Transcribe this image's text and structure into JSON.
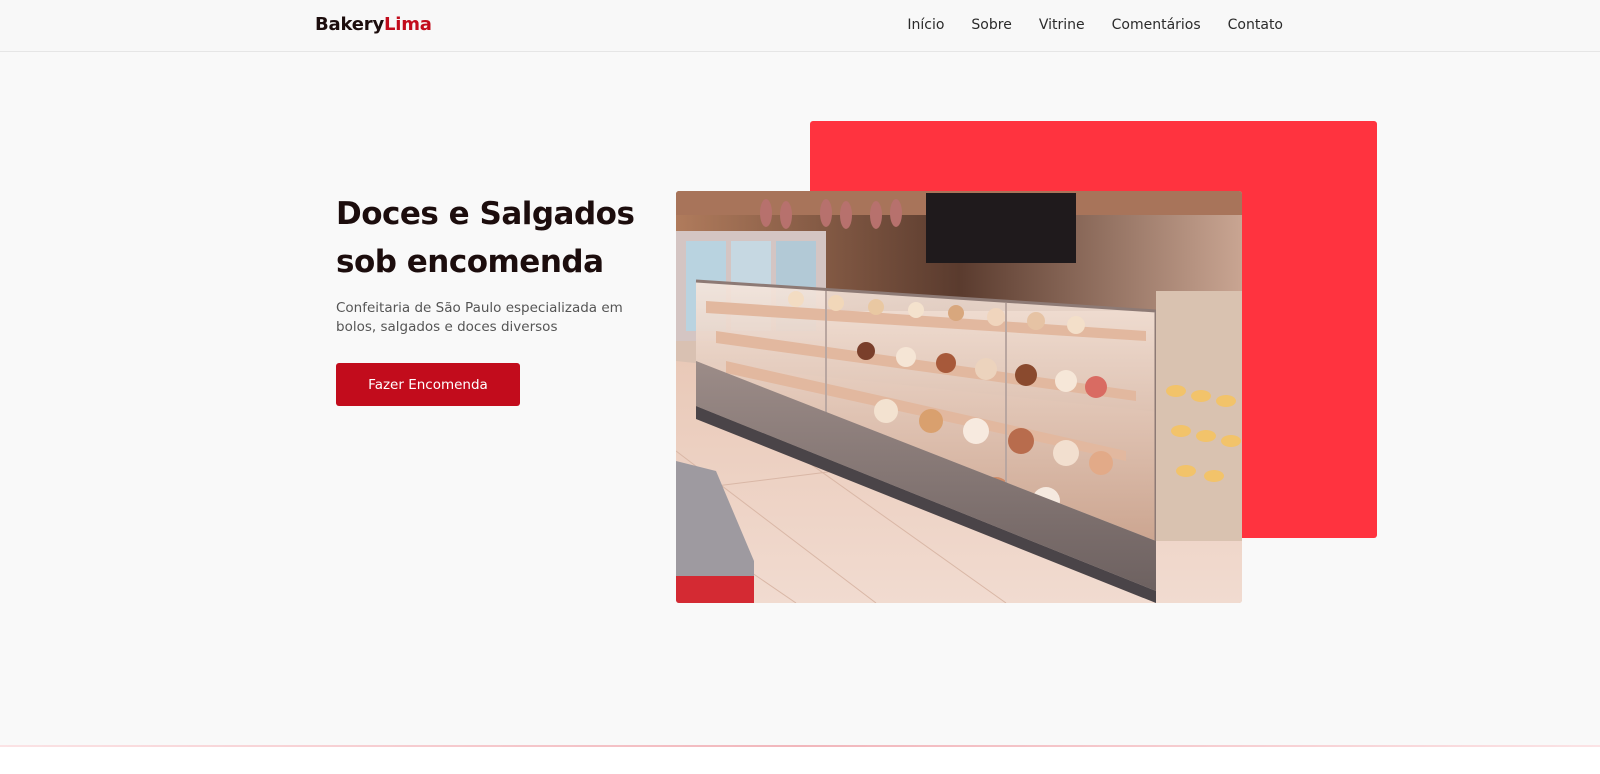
{
  "brand": {
    "part1": "Bakery",
    "part2": "Lima"
  },
  "nav": {
    "items": [
      {
        "label": "Início"
      },
      {
        "label": "Sobre"
      },
      {
        "label": "Vitrine"
      },
      {
        "label": "Comentários"
      },
      {
        "label": "Contato"
      }
    ]
  },
  "hero": {
    "title": "Doces e Salgados sob encomenda",
    "subtitle": "Confeitaria de São Paulo especializada em bolos, salgados e doces diversos",
    "cta_label": "Fazer Encomenda"
  },
  "colors": {
    "accent": "#c20c1c",
    "accent_light": "#ff333f",
    "text": "#1c0d0d"
  }
}
